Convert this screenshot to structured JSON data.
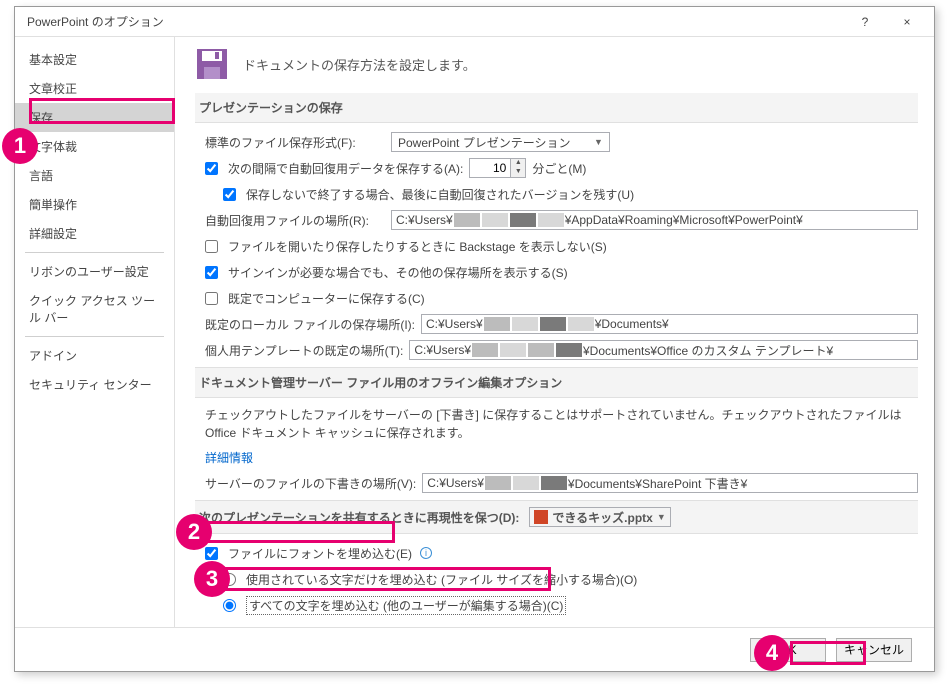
{
  "titlebar": {
    "title": "PowerPoint のオプション",
    "help": "?",
    "close": "×"
  },
  "sidebar": {
    "items": [
      "基本設定",
      "文章校正",
      "保存",
      "文字体裁",
      "言語",
      "簡単操作",
      "詳細設定",
      "リボンのユーザー設定",
      "クイック アクセス ツール バー",
      "アドイン",
      "セキュリティ センター"
    ],
    "selected_index": 2
  },
  "header": {
    "text": "ドキュメントの保存方法を設定します。"
  },
  "section1": {
    "title": "プレゼンテーションの保存",
    "default_format_label": "標準のファイル保存形式(F):",
    "default_format_value": "PowerPoint プレゼンテーション",
    "autorecover_label_pre": "次の間隔で自動回復用データを保存する(A):",
    "autorecover_minutes": "10",
    "autorecover_label_post": "分ごと(M)",
    "keep_last_label": "保存しないで終了する場合、最後に自動回復されたバージョンを残す(U)",
    "autorecover_path_label": "自動回復用ファイルの場所(R):",
    "autorecover_path_pre": "C:¥Users¥",
    "autorecover_path_post": "¥AppData¥Roaming¥Microsoft¥PowerPoint¥",
    "no_backstage_label": "ファイルを開いたり保存したりするときに Backstage を表示しない(S)",
    "show_other_label": "サインインが必要な場合でも、その他の保存場所を表示する(S)",
    "save_local_label": "既定でコンピューターに保存する(C)",
    "default_local_label": "既定のローカル ファイルの保存場所(I):",
    "default_local_pre": "C:¥Users¥",
    "default_local_post": "¥Documents¥",
    "templates_label": "個人用テンプレートの既定の場所(T):",
    "templates_pre": "C:¥Users¥",
    "templates_post": "¥Documents¥Office のカスタム テンプレート¥"
  },
  "section2": {
    "title": "ドキュメント管理サーバー ファイル用のオフライン編集オプション",
    "desc": "チェックアウトしたファイルをサーバーの [下書き] に保存することはサポートされていません。チェックアウトされたファイルは Office ドキュメント キャッシュに保存されます。",
    "detail_link": "詳細情報",
    "drafts_label": "サーバーのファイルの下書きの場所(V):",
    "drafts_pre": "C:¥Users¥",
    "drafts_post": "¥Documents¥SharePoint 下書き¥"
  },
  "section3": {
    "title_pre": "次のプレゼンテーションを共有するときに再現性を保つ(D):",
    "file_value": "できるキッズ.pptx",
    "embed_fonts_label": "ファイルにフォントを埋め込む(E)",
    "radio_used_label": "使用されている文字だけを埋め込む (ファイル サイズを縮小する場合)(O)",
    "radio_all_label": "すべての文字を埋め込む (他のユーザーが編集する場合)(C)"
  },
  "buttons": {
    "ok": "OK",
    "cancel": "キャンセル"
  },
  "callouts": {
    "c1": "1",
    "c2": "2",
    "c3": "3",
    "c4": "4"
  }
}
